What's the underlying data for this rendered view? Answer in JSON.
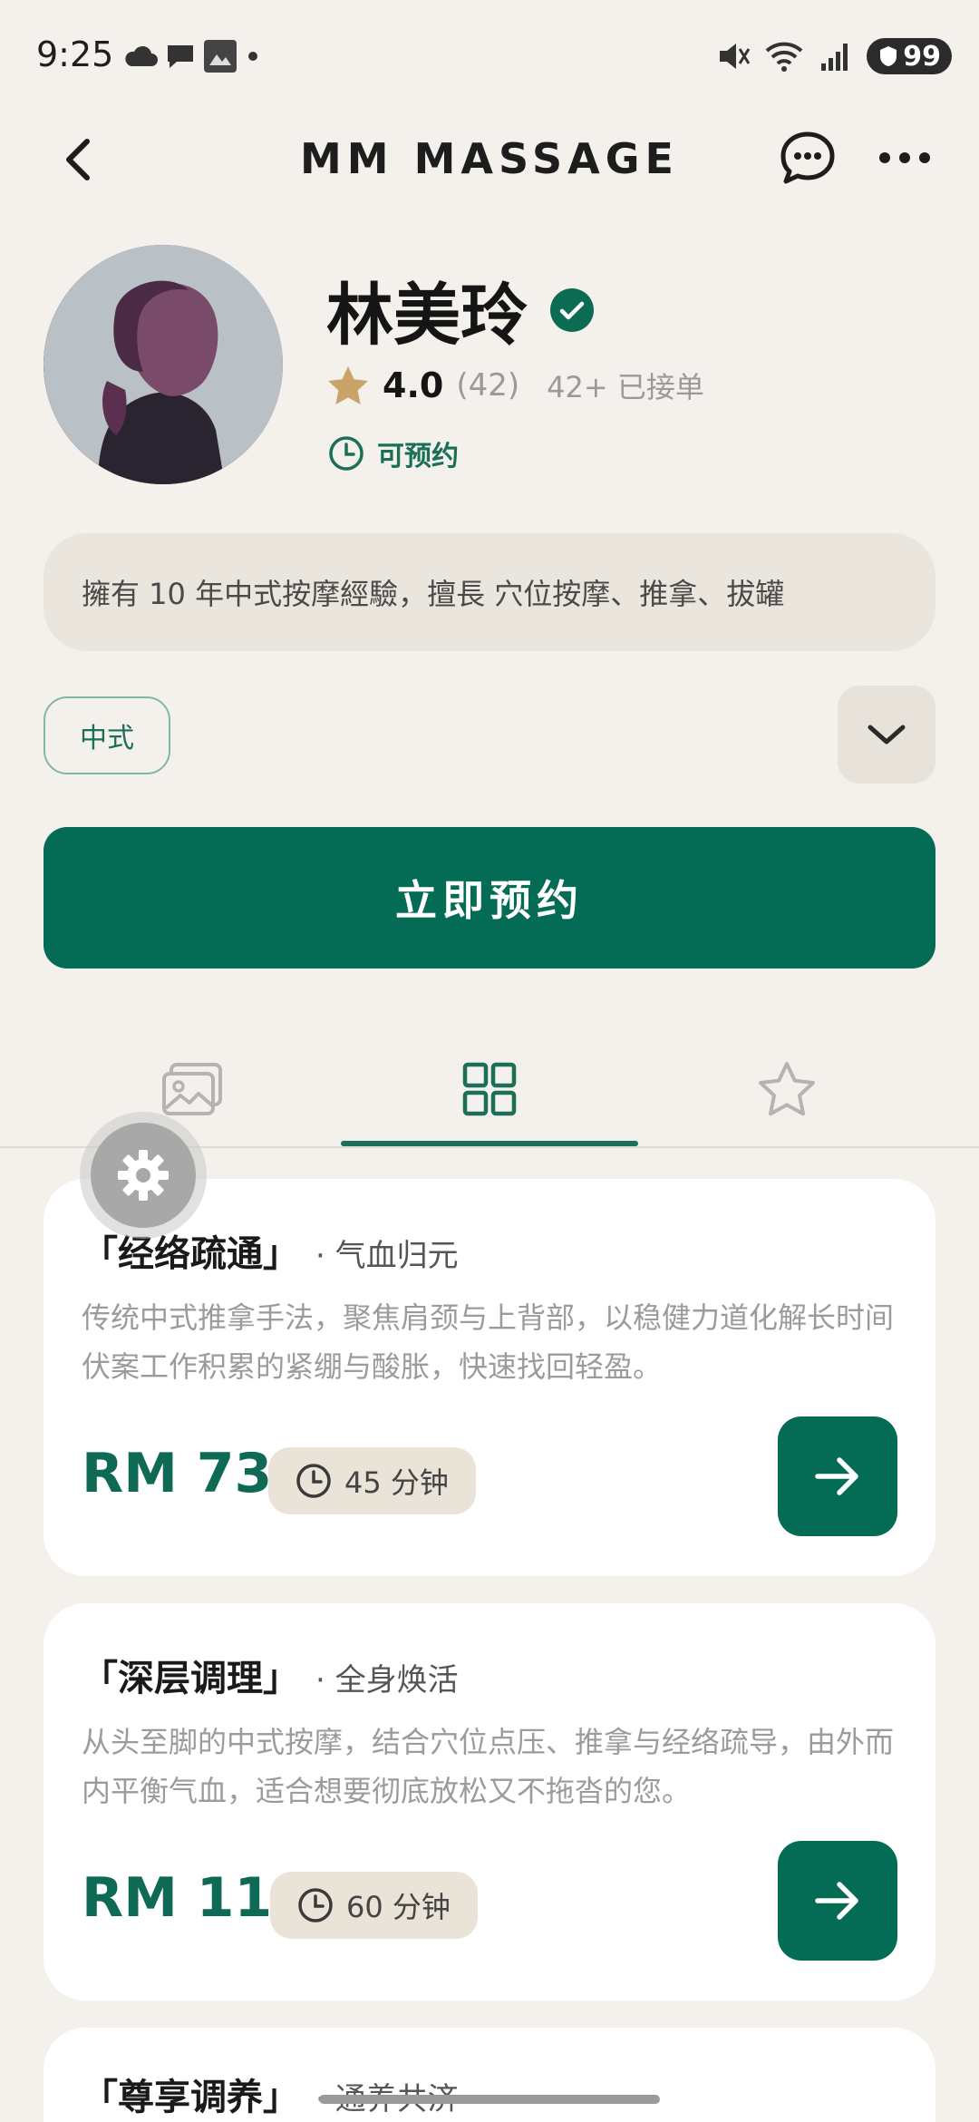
{
  "status": {
    "time": "9:25",
    "battery": "99"
  },
  "nav": {
    "title": "MM MASSAGE"
  },
  "profile": {
    "name": "林美玲",
    "rating": "4.0",
    "rating_count": "(42)",
    "orders": "42+ 已接单",
    "availability": "可预约",
    "bio": "擁有 10 年中式按摩經驗，擅長 穴位按摩、推拿、拔罐",
    "tag": "中式"
  },
  "book_button": "立即预约",
  "tabs": [
    {
      "icon": "gallery-icon",
      "active": false
    },
    {
      "icon": "grid-icon",
      "active": true
    },
    {
      "icon": "star-outline-icon",
      "active": false
    }
  ],
  "services": [
    {
      "title": "「经络疏通」",
      "subtitle": "· 气血归元",
      "description": "传统中式推拿手法，聚焦肩颈与上背部，以稳健力道化解长时间伏案工作积累的紧绷与酸胀，快速找回轻盈。",
      "price": "RM 73",
      "duration": "45 分钟"
    },
    {
      "title": "「深层调理」",
      "subtitle": "· 全身焕活",
      "description": "从头至脚的中式按摩，结合穴位点压、推拿与经络疏导，由外而内平衡气血，适合想要彻底放松又不拖沓的您。",
      "price": "RM 111",
      "duration": "60 分钟"
    },
    {
      "title": "「尊享调养」",
      "subtitle": "· 通养共济"
    }
  ],
  "colors": {
    "brand": "#046C54",
    "background": "#F4F1EC",
    "accent_gold": "#C9A46A"
  }
}
